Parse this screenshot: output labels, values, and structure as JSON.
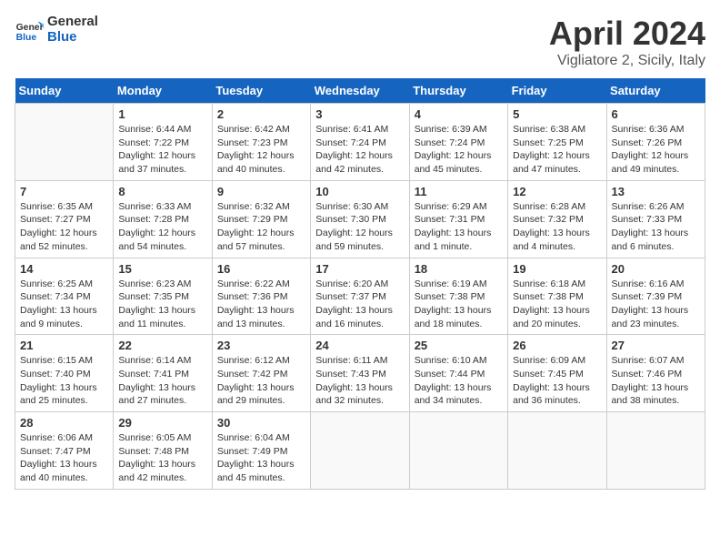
{
  "header": {
    "logo_line1": "General",
    "logo_line2": "Blue",
    "month_title": "April 2024",
    "subtitle": "Vigliatore 2, Sicily, Italy"
  },
  "weekdays": [
    "Sunday",
    "Monday",
    "Tuesday",
    "Wednesday",
    "Thursday",
    "Friday",
    "Saturday"
  ],
  "weeks": [
    [
      {
        "day": "",
        "sunrise": "",
        "sunset": "",
        "daylight": ""
      },
      {
        "day": "1",
        "sunrise": "Sunrise: 6:44 AM",
        "sunset": "Sunset: 7:22 PM",
        "daylight": "Daylight: 12 hours and 37 minutes."
      },
      {
        "day": "2",
        "sunrise": "Sunrise: 6:42 AM",
        "sunset": "Sunset: 7:23 PM",
        "daylight": "Daylight: 12 hours and 40 minutes."
      },
      {
        "day": "3",
        "sunrise": "Sunrise: 6:41 AM",
        "sunset": "Sunset: 7:24 PM",
        "daylight": "Daylight: 12 hours and 42 minutes."
      },
      {
        "day": "4",
        "sunrise": "Sunrise: 6:39 AM",
        "sunset": "Sunset: 7:24 PM",
        "daylight": "Daylight: 12 hours and 45 minutes."
      },
      {
        "day": "5",
        "sunrise": "Sunrise: 6:38 AM",
        "sunset": "Sunset: 7:25 PM",
        "daylight": "Daylight: 12 hours and 47 minutes."
      },
      {
        "day": "6",
        "sunrise": "Sunrise: 6:36 AM",
        "sunset": "Sunset: 7:26 PM",
        "daylight": "Daylight: 12 hours and 49 minutes."
      }
    ],
    [
      {
        "day": "7",
        "sunrise": "Sunrise: 6:35 AM",
        "sunset": "Sunset: 7:27 PM",
        "daylight": "Daylight: 12 hours and 52 minutes."
      },
      {
        "day": "8",
        "sunrise": "Sunrise: 6:33 AM",
        "sunset": "Sunset: 7:28 PM",
        "daylight": "Daylight: 12 hours and 54 minutes."
      },
      {
        "day": "9",
        "sunrise": "Sunrise: 6:32 AM",
        "sunset": "Sunset: 7:29 PM",
        "daylight": "Daylight: 12 hours and 57 minutes."
      },
      {
        "day": "10",
        "sunrise": "Sunrise: 6:30 AM",
        "sunset": "Sunset: 7:30 PM",
        "daylight": "Daylight: 12 hours and 59 minutes."
      },
      {
        "day": "11",
        "sunrise": "Sunrise: 6:29 AM",
        "sunset": "Sunset: 7:31 PM",
        "daylight": "Daylight: 13 hours and 1 minute."
      },
      {
        "day": "12",
        "sunrise": "Sunrise: 6:28 AM",
        "sunset": "Sunset: 7:32 PM",
        "daylight": "Daylight: 13 hours and 4 minutes."
      },
      {
        "day": "13",
        "sunrise": "Sunrise: 6:26 AM",
        "sunset": "Sunset: 7:33 PM",
        "daylight": "Daylight: 13 hours and 6 minutes."
      }
    ],
    [
      {
        "day": "14",
        "sunrise": "Sunrise: 6:25 AM",
        "sunset": "Sunset: 7:34 PM",
        "daylight": "Daylight: 13 hours and 9 minutes."
      },
      {
        "day": "15",
        "sunrise": "Sunrise: 6:23 AM",
        "sunset": "Sunset: 7:35 PM",
        "daylight": "Daylight: 13 hours and 11 minutes."
      },
      {
        "day": "16",
        "sunrise": "Sunrise: 6:22 AM",
        "sunset": "Sunset: 7:36 PM",
        "daylight": "Daylight: 13 hours and 13 minutes."
      },
      {
        "day": "17",
        "sunrise": "Sunrise: 6:20 AM",
        "sunset": "Sunset: 7:37 PM",
        "daylight": "Daylight: 13 hours and 16 minutes."
      },
      {
        "day": "18",
        "sunrise": "Sunrise: 6:19 AM",
        "sunset": "Sunset: 7:38 PM",
        "daylight": "Daylight: 13 hours and 18 minutes."
      },
      {
        "day": "19",
        "sunrise": "Sunrise: 6:18 AM",
        "sunset": "Sunset: 7:38 PM",
        "daylight": "Daylight: 13 hours and 20 minutes."
      },
      {
        "day": "20",
        "sunrise": "Sunrise: 6:16 AM",
        "sunset": "Sunset: 7:39 PM",
        "daylight": "Daylight: 13 hours and 23 minutes."
      }
    ],
    [
      {
        "day": "21",
        "sunrise": "Sunrise: 6:15 AM",
        "sunset": "Sunset: 7:40 PM",
        "daylight": "Daylight: 13 hours and 25 minutes."
      },
      {
        "day": "22",
        "sunrise": "Sunrise: 6:14 AM",
        "sunset": "Sunset: 7:41 PM",
        "daylight": "Daylight: 13 hours and 27 minutes."
      },
      {
        "day": "23",
        "sunrise": "Sunrise: 6:12 AM",
        "sunset": "Sunset: 7:42 PM",
        "daylight": "Daylight: 13 hours and 29 minutes."
      },
      {
        "day": "24",
        "sunrise": "Sunrise: 6:11 AM",
        "sunset": "Sunset: 7:43 PM",
        "daylight": "Daylight: 13 hours and 32 minutes."
      },
      {
        "day": "25",
        "sunrise": "Sunrise: 6:10 AM",
        "sunset": "Sunset: 7:44 PM",
        "daylight": "Daylight: 13 hours and 34 minutes."
      },
      {
        "day": "26",
        "sunrise": "Sunrise: 6:09 AM",
        "sunset": "Sunset: 7:45 PM",
        "daylight": "Daylight: 13 hours and 36 minutes."
      },
      {
        "day": "27",
        "sunrise": "Sunrise: 6:07 AM",
        "sunset": "Sunset: 7:46 PM",
        "daylight": "Daylight: 13 hours and 38 minutes."
      }
    ],
    [
      {
        "day": "28",
        "sunrise": "Sunrise: 6:06 AM",
        "sunset": "Sunset: 7:47 PM",
        "daylight": "Daylight: 13 hours and 40 minutes."
      },
      {
        "day": "29",
        "sunrise": "Sunrise: 6:05 AM",
        "sunset": "Sunset: 7:48 PM",
        "daylight": "Daylight: 13 hours and 42 minutes."
      },
      {
        "day": "30",
        "sunrise": "Sunrise: 6:04 AM",
        "sunset": "Sunset: 7:49 PM",
        "daylight": "Daylight: 13 hours and 45 minutes."
      },
      {
        "day": "",
        "sunrise": "",
        "sunset": "",
        "daylight": ""
      },
      {
        "day": "",
        "sunrise": "",
        "sunset": "",
        "daylight": ""
      },
      {
        "day": "",
        "sunrise": "",
        "sunset": "",
        "daylight": ""
      },
      {
        "day": "",
        "sunrise": "",
        "sunset": "",
        "daylight": ""
      }
    ]
  ]
}
